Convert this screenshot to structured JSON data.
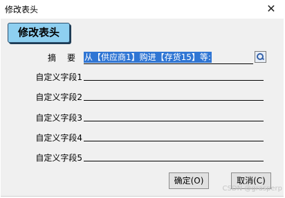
{
  "window": {
    "title": "修改表头",
    "close_glyph": "✕"
  },
  "header": {
    "badge_label": "修改表头"
  },
  "form": {
    "summary": {
      "label": "摘要",
      "value": "从【供应商1】购进【存货15】等:"
    },
    "custom_fields": [
      {
        "label": "自定义字段1",
        "value": ""
      },
      {
        "label": "自定义字段2",
        "value": ""
      },
      {
        "label": "自定义字段3",
        "value": ""
      },
      {
        "label": "自定义字段4",
        "value": ""
      },
      {
        "label": "自定义字段5",
        "value": ""
      }
    ]
  },
  "buttons": {
    "ok": "确定(O)",
    "cancel": "取消(C)"
  },
  "watermark": "CSDN @grasperp"
}
